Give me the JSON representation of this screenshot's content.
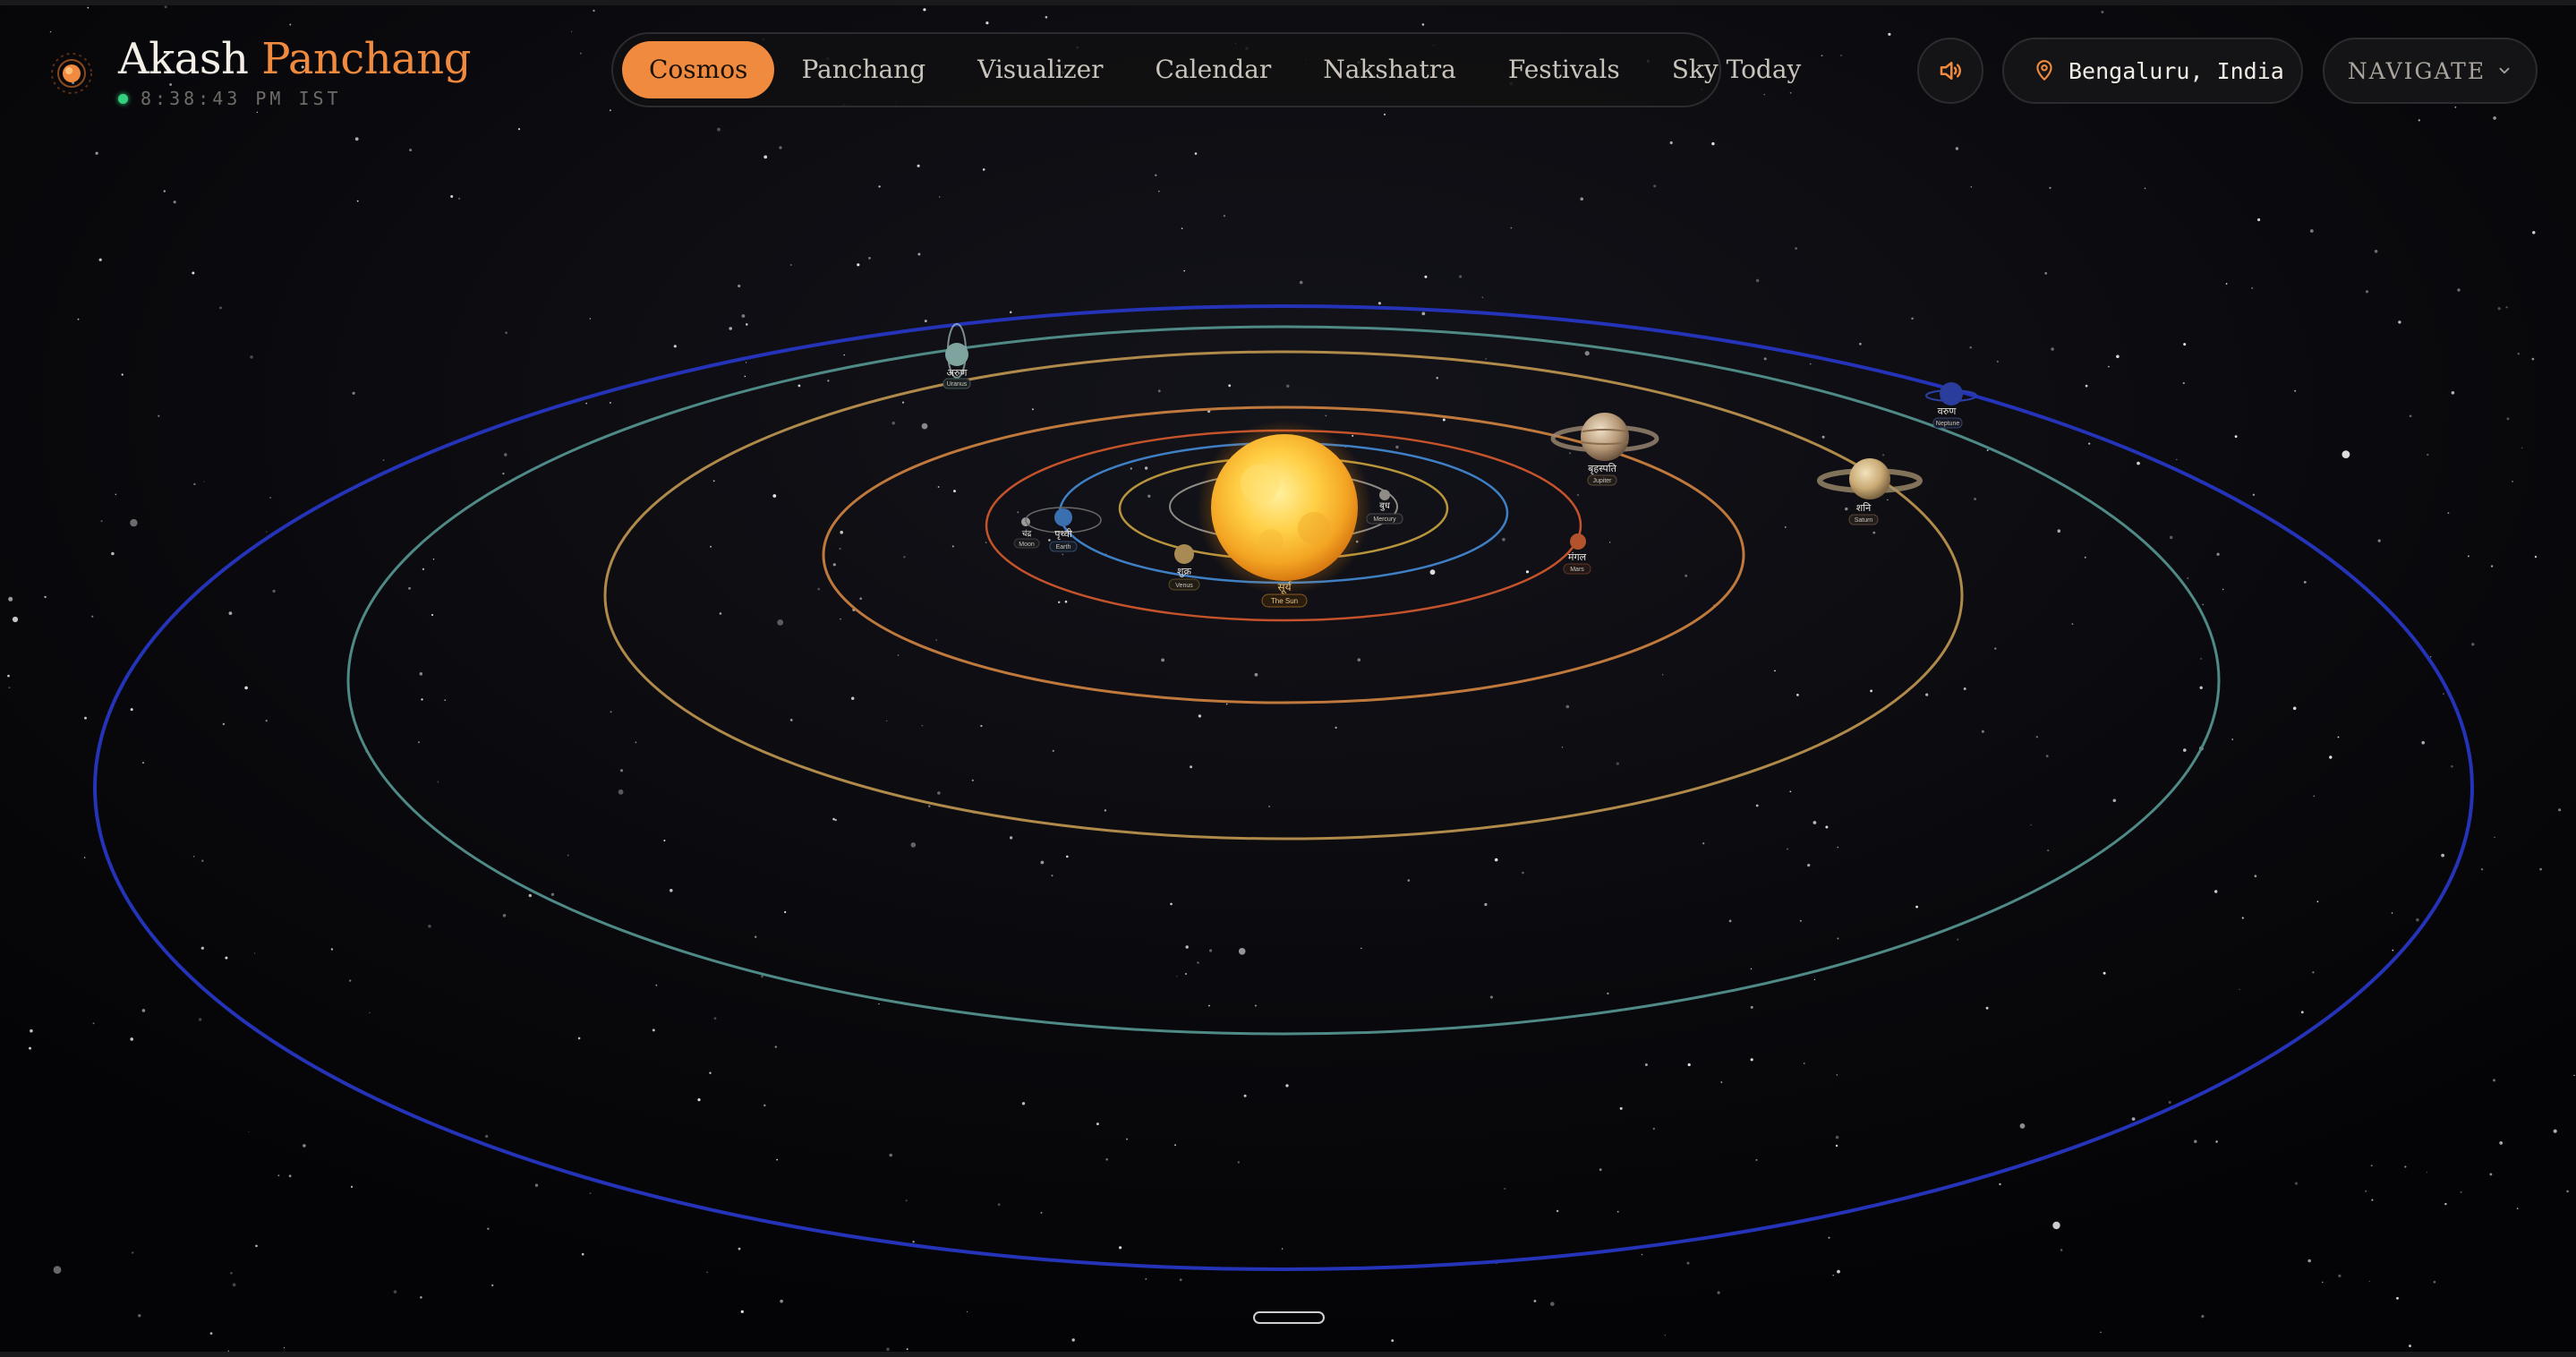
{
  "brand": {
    "name_part1": "Akash",
    "name_part2": "Panchang",
    "clock": "8:38:43 PM IST",
    "status_color": "#35d07f",
    "accent_color": "#f08a3e"
  },
  "nav": {
    "tabs": [
      {
        "label": "Cosmos",
        "active": true
      },
      {
        "label": "Panchang",
        "active": false
      },
      {
        "label": "Visualizer",
        "active": false
      },
      {
        "label": "Calendar",
        "active": false
      },
      {
        "label": "Nakshatra",
        "active": false
      },
      {
        "label": "Festivals",
        "active": false
      },
      {
        "label": "Sky Today",
        "active": false
      }
    ]
  },
  "controls": {
    "sound_icon": "speaker-icon",
    "location_icon": "map-pin-icon",
    "location": "Bengaluru, India",
    "navigate": "NAVIGATE",
    "navigate_icon": "chevron-down-icon"
  },
  "bodies": {
    "sun": {
      "native": "सूर्य",
      "name": "The Sun"
    },
    "mercury": {
      "native": "बुध",
      "name": "Mercury"
    },
    "venus": {
      "native": "शुक्र",
      "name": "Venus"
    },
    "earth": {
      "native": "पृथ्वी",
      "name": "Earth"
    },
    "moon": {
      "native": "चंद्र",
      "name": "Moon"
    },
    "mars": {
      "native": "मंगल",
      "name": "Mars"
    },
    "jupiter": {
      "native": "बृहस्पति",
      "name": "Jupiter"
    },
    "saturn": {
      "native": "शनि",
      "name": "Saturn"
    },
    "uranus": {
      "native": "अरुण",
      "name": "Uranus"
    },
    "neptune": {
      "native": "वरुण",
      "name": "Neptune"
    }
  },
  "orbit_colors": {
    "mercury": "#8e8a84",
    "venus": "#b8943c",
    "earth": "#3f7fc4",
    "mars": "#c4532b",
    "jupiter": "#c0793d",
    "saturn": "#b08a4a",
    "uranus": "#4f8a86",
    "neptune": "#2433b8"
  }
}
